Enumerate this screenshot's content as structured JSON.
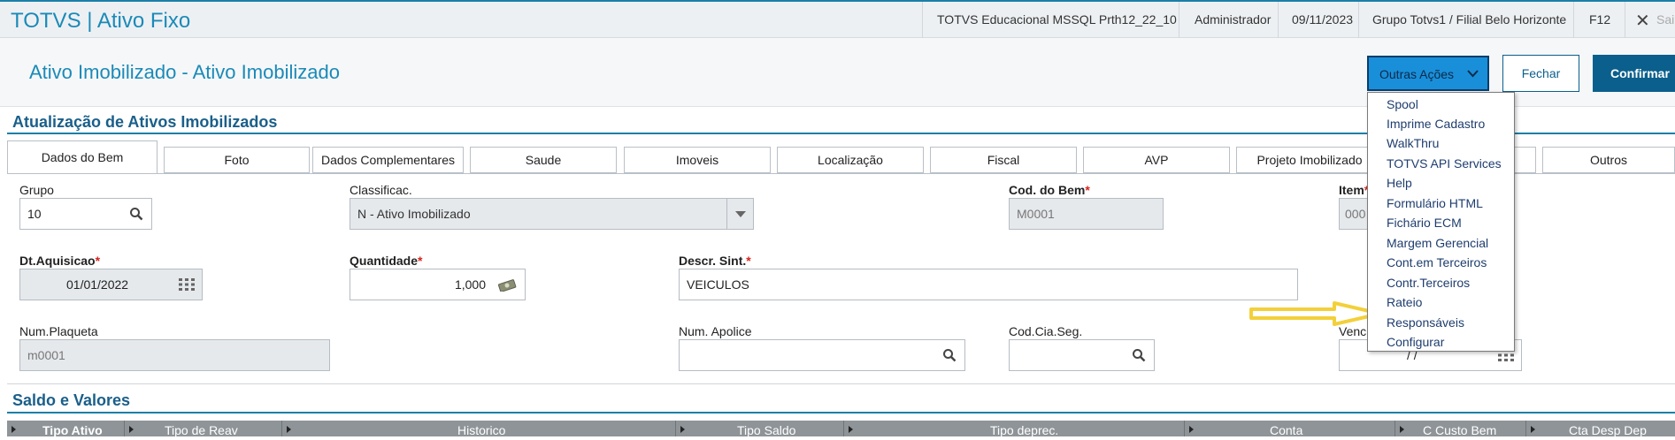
{
  "topbar": {
    "app_title": "TOTVS | Ativo Fixo",
    "environment": "TOTVS Educacional MSSQL Prth12_22_10",
    "user": "Administrador",
    "date": "09/11/2023",
    "branch": "Grupo Totvs1 / Filial Belo Horizonte",
    "shortcut": "F12",
    "exit_label": "Sai"
  },
  "header": {
    "page_title": "Ativo Imobilizado - Ativo Imobilizado",
    "other_actions_label": "Outras Ações",
    "close_label": "Fechar",
    "confirm_label": "Confirmar"
  },
  "section1": {
    "title": "Atualização de Ativos Imobilizados"
  },
  "tabs": [
    "Dados do Bem",
    "Foto",
    "Dados Complementares",
    "Saude",
    "Imoveis",
    "Localização",
    "Fiscal",
    "AVP",
    "Projeto Imobilizado",
    "",
    "Outros"
  ],
  "fields": {
    "grupo": {
      "label": "Grupo",
      "value": "10"
    },
    "classificacao": {
      "label": "Classificac.",
      "value": "N - Ativo Imobilizado"
    },
    "cod_bem": {
      "label": "Cod. do Bem",
      "value": "M0001"
    },
    "item": {
      "label": "Item",
      "value": "000"
    },
    "dt_aquisicao": {
      "label": "Dt.Aquisicao",
      "value": "01/01/2022"
    },
    "quantidade": {
      "label": "Quantidade",
      "value": "1,000"
    },
    "descr_sint": {
      "label": "Descr. Sint.",
      "value": "VEICULOS"
    },
    "num_plaqueta": {
      "label": "Num.Plaqueta",
      "value": "m0001"
    },
    "num_apolice": {
      "label": "Num. Apolice",
      "value": ""
    },
    "cod_cia_seg": {
      "label": "Cod.Cia.Seg.",
      "value": ""
    },
    "venc": {
      "label": "Venc",
      "value": "/ /"
    },
    "required_mark": "*"
  },
  "menu": {
    "items": [
      "Spool",
      "Imprime Cadastro",
      "WalkThru",
      "TOTVS API Services",
      "Help",
      "Formulário HTML",
      "Fichário ECM",
      "Margem Gerencial",
      "Cont.em Terceiros",
      "Contr.Terceiros",
      "Rateio",
      "Responsáveis",
      "Configurar"
    ]
  },
  "section2": {
    "title": "Saldo e Valores"
  },
  "grid": {
    "columns": [
      "Tipo Ativo",
      "Tipo de Reav",
      "Historico",
      "Tipo Saldo",
      "Tipo deprec.",
      "Conta",
      "C Custo Bem",
      "Cta Desp Dep"
    ]
  },
  "colors": {
    "accent": "#1a8ab8",
    "primary_button": "#0b5f8c",
    "menu_button": "#1a8fd9",
    "highlight_arrow": "#f3d03a",
    "required": "#d9221c"
  },
  "icons": [
    "search-icon",
    "calendar-icon",
    "money-icon",
    "chevron-down-icon",
    "close-icon",
    "arrow-annotation"
  ]
}
